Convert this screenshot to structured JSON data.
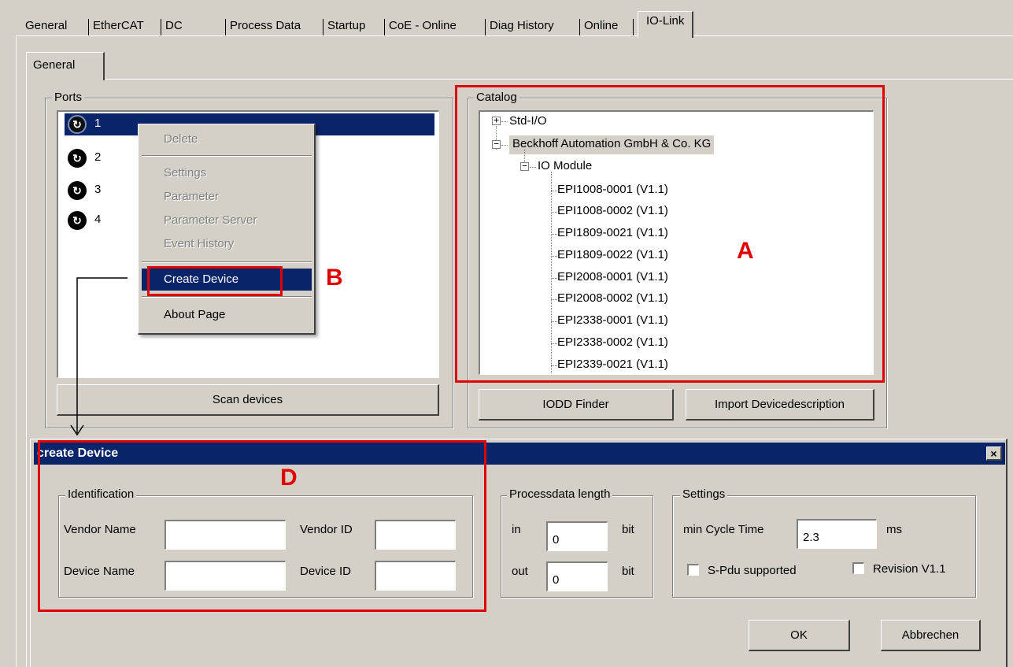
{
  "tabs": [
    "General",
    "EtherCAT",
    "DC",
    "Process Data",
    "Startup",
    "CoE - Online",
    "Diag History",
    "Online",
    "IO-Link"
  ],
  "inner_tab": "General",
  "ports": {
    "label": "Ports",
    "items": [
      "1",
      "2",
      "3",
      "4"
    ],
    "scan_button": "Scan devices"
  },
  "context_menu": {
    "delete": "Delete",
    "settings": "Settings",
    "parameter": "Parameter",
    "parameter_server": "Parameter Server",
    "event_history": "Event History",
    "create_device": "Create Device",
    "about_page": "About Page"
  },
  "catalog": {
    "label": "Catalog",
    "root_std": "Std-I/O",
    "root_vendor": "Beckhoff Automation GmbH & Co. KG",
    "module_group": "IO Module",
    "modules": [
      "EPI1008-0001 (V1.1)",
      "EPI1008-0002 (V1.1)",
      "EPI1809-0021 (V1.1)",
      "EPI1809-0022 (V1.1)",
      "EPI2008-0001 (V1.1)",
      "EPI2008-0002 (V1.1)",
      "EPI2338-0001 (V1.1)",
      "EPI2338-0002 (V1.1)",
      "EPI2339-0021 (V1.1)"
    ],
    "iodd_button": "IODD Finder",
    "import_button": "Import Devicedescription"
  },
  "annotations": {
    "a": "A",
    "b": "B",
    "d": "D",
    "color": "#e00000"
  },
  "dialog": {
    "title": "create Device",
    "close": "×",
    "identification": {
      "label": "Identification",
      "vendor_name": "Vendor Name",
      "vendor_id": "Vendor ID",
      "device_name": "Device Name",
      "device_id": "Device ID",
      "vendor_name_value": "",
      "vendor_id_value": "",
      "device_name_value": "",
      "device_id_value": ""
    },
    "processdata": {
      "label": "Processdata length",
      "in": "in",
      "out": "out",
      "in_value": "0",
      "out_value": "0",
      "unit": "bit"
    },
    "settings": {
      "label": "Settings",
      "min_cycle_label": "min Cycle Time",
      "min_cycle_value": "2.3",
      "min_cycle_unit": "ms",
      "spdu": "S-Pdu supported",
      "revision": "Revision V1.1"
    },
    "ok": "OK",
    "cancel": "Abbrechen"
  },
  "colors": {
    "selection": "#0a246a",
    "face": "#d4d0c8",
    "annotation_red": "#e00000"
  }
}
